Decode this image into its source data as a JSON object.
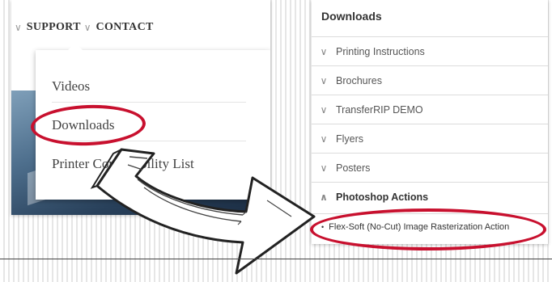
{
  "left_panel": {
    "nav": {
      "support": "SUPPORT",
      "contact": "CONTACT"
    },
    "dropdown": {
      "items": [
        "Videos",
        "Downloads",
        "Printer Compatibility List"
      ]
    }
  },
  "right_panel": {
    "title": "Downloads",
    "items": [
      "Printing Instructions",
      "Brochures",
      "TransferRIP DEMO",
      "Flyers",
      "Posters",
      "Photoshop Actions"
    ],
    "active_item": "Photoshop Actions",
    "sub_items": [
      "Flex-Soft (No-Cut) Image Rasterization Action"
    ]
  },
  "colors": {
    "highlight": "#c8102e"
  },
  "icons": {
    "chevron": "chevron-down-icon",
    "chevron_up": "chevron-up-icon",
    "arrow": "curved-arrow-icon"
  }
}
